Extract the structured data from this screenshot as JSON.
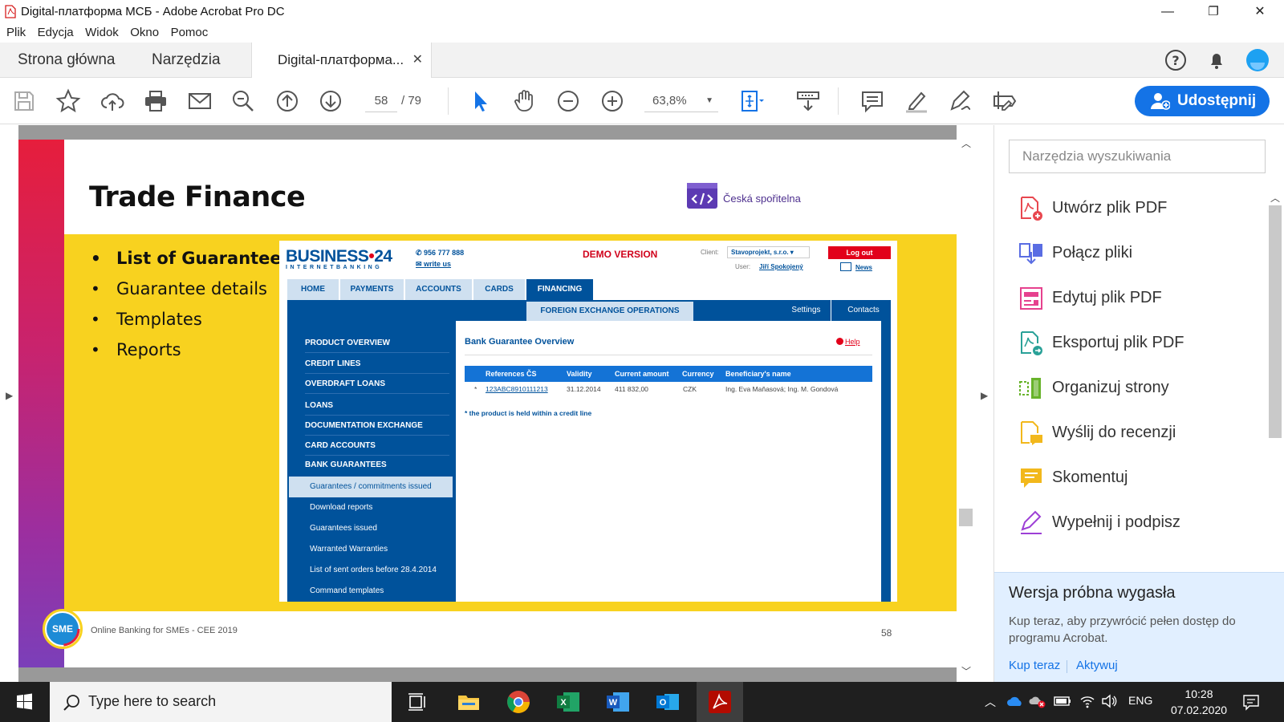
{
  "window": {
    "title": "Digital-платформа МСБ - Adobe Acrobat Pro DC",
    "controls": [
      "—",
      "❐",
      "✕"
    ]
  },
  "menu": [
    "Plik",
    "Edycja",
    "Widok",
    "Okno",
    "Pomoc"
  ],
  "tabs": {
    "home": "Strona główna",
    "tools": "Narzędzia",
    "document": "Digital-платформа...",
    "close": "✕"
  },
  "toolbar": {
    "page_current": "58",
    "page_total": "/ 79",
    "zoom": "63,8%",
    "share_label": "Udostępnij"
  },
  "slide": {
    "title": "Trade Finance",
    "brand": "Česká spořitelna",
    "bullets": [
      "List of Guarantees",
      "Guarantee details",
      "Templates",
      "Reports"
    ],
    "footer": "Online Banking for SMEs - CEE 2019",
    "page_number": "58",
    "footer_logo_text": "SME"
  },
  "bank": {
    "logo_main": "BUSINESS",
    "logo_dot": "•",
    "logo_num": "24",
    "logo_sub": "INTERNETBANKING",
    "phone": "956 777 888",
    "write_us": "write us",
    "demo": "DEMO VERSION",
    "client_label": "Client:",
    "client_value": "Stavoprojekt, s.r.o. ▾",
    "user_label": "User:",
    "user_value": "Jiří Spokojený",
    "logout": "Log out",
    "news": "News",
    "tabs": [
      "HOME",
      "PAYMENTS",
      "ACCOUNTS",
      "CARDS",
      "FINANCING"
    ],
    "subtab": "FOREIGN EXCHANGE OPERATIONS",
    "settings": "Settings",
    "contacts": "Contacts",
    "side_items": [
      "PRODUCT OVERVIEW",
      "CREDIT LINES",
      "OVERDRAFT LOANS",
      "LOANS",
      "DOCUMENTATION EXCHANGE",
      "CARD ACCOUNTS",
      "BANK GUARANTEES"
    ],
    "side_subitems": [
      "Guarantees / commitments issued",
      "Download reports",
      "Guarantees issued",
      "Warranted Warranties",
      "List of sent orders before 28.4.2014",
      "Command templates"
    ],
    "heading": "Bank Guarantee Overview",
    "help": "Help",
    "columns": [
      "References ČS",
      "Validity",
      "Current amount",
      "Currency",
      "Beneficiary's name"
    ],
    "row": {
      "marker": "*",
      "reference": "123ABC8910111213",
      "validity": "31.12.2014",
      "amount": "411 832,00",
      "currency": "CZK",
      "beneficiary": "Ing. Eva Maňasová; Ing. M. Gondová"
    },
    "note": "* the product is held within a credit line"
  },
  "rightpane": {
    "search_placeholder": "Narzędzia wyszukiwania",
    "tools": [
      {
        "label": "Utwórz plik PDF",
        "icon": "create-pdf-icon",
        "color": "#e8474f"
      },
      {
        "label": "Połącz pliki",
        "icon": "combine-files-icon",
        "color": "#5a6de3"
      },
      {
        "label": "Edytuj plik PDF",
        "icon": "edit-pdf-icon",
        "color": "#e6418e"
      },
      {
        "label": "Eksportuj plik PDF",
        "icon": "export-pdf-icon",
        "color": "#2aa198"
      },
      {
        "label": "Organizuj strony",
        "icon": "organize-pages-icon",
        "color": "#68b32b"
      },
      {
        "label": "Wyślij do recenzji",
        "icon": "send-review-icon",
        "color": "#f2b81c"
      },
      {
        "label": "Skomentuj",
        "icon": "comment-icon",
        "color": "#f2b81c"
      },
      {
        "label": "Wypełnij i podpisz",
        "icon": "fill-sign-icon",
        "color": "#9d3fd6"
      }
    ],
    "trial": {
      "heading": "Wersja próbna wygasła",
      "text": "Kup teraz, aby przywrócić pełen dostęp do programu Acrobat.",
      "buy": "Kup teraz",
      "activate": "Aktywuj"
    }
  },
  "taskbar": {
    "search_placeholder": "Type here to search",
    "lang": "ENG",
    "time": "10:28",
    "date": "07.02.2020"
  },
  "colors": {
    "accent": "#1473e6",
    "bank_blue": "#00529b",
    "slide_yellow": "#f8d21f"
  }
}
